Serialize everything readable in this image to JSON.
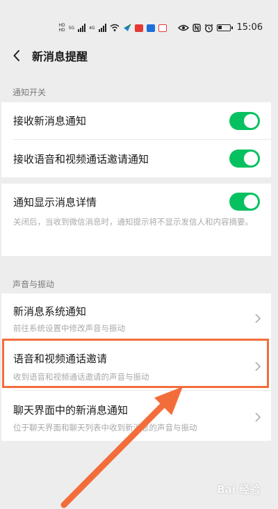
{
  "status_bar": {
    "chip_hd1": "HD",
    "chip_hd2": "HD",
    "net_5g": "5G",
    "net_4g": "4G",
    "time": "15:06",
    "icons": [
      "signal-icon",
      "wifi-icon",
      "eye-icon",
      "nfc-icon",
      "alarm-icon",
      "battery-icon"
    ]
  },
  "nav": {
    "title": "新消息提醒"
  },
  "sections": {
    "notification_switch": "通知开关",
    "sound_vibration": "声音与振动"
  },
  "toggles": {
    "receive_new_msg": "接收新消息通知",
    "receive_av_invite": "接收语音和视频通话邀请通知",
    "show_details": "通知显示消息详情",
    "show_details_desc": "关闭后，当收到微信消息时，通知提示将不显示发信人和内容摘要。"
  },
  "items": {
    "new_msg_system": {
      "title": "新消息系统通知",
      "sub": "前往系统设置中修改声音与振动"
    },
    "av_invite": {
      "title": "语音和视频通话邀请",
      "sub": "收到语音和视频通话邀请的声音与振动"
    },
    "chat_new_msg": {
      "title": "聊天界面中的新消息通知",
      "sub": "位于聊天界面和聊天列表中收到新消息的声音与振动"
    }
  },
  "watermark": "Bai 经验",
  "colors": {
    "toggle_on": "#07c160",
    "highlight": "#f36d3b",
    "background": "#ededed"
  }
}
